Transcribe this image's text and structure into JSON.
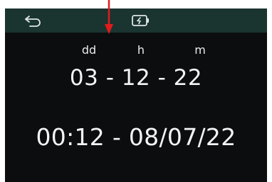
{
  "header": {
    "back_icon": "back-arrow-icon",
    "timer_icon": "timer-battery-icon",
    "bar_color": "#1a3430"
  },
  "units": {
    "days": "dd",
    "hours": "h",
    "minutes": "m"
  },
  "duration_text": "03 - 12 - 22",
  "datetime_text": "00:12 - 08/07/22",
  "annotation": {
    "arrow_icon": "red-arrow-icon",
    "color": "#e11b1b"
  }
}
